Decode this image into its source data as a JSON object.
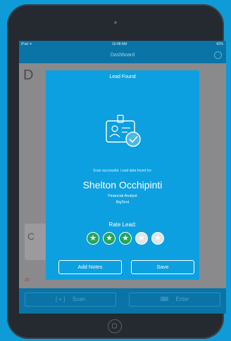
{
  "status": {
    "left": "iPad ᯤ",
    "time": "10:48 AM",
    "battery": "42%"
  },
  "nav": {
    "title": "Dashboard"
  },
  "background": {
    "title": "D",
    "card_letter": "C",
    "number": "20"
  },
  "modal": {
    "title": "Lead Found",
    "status": "Scan successful. Lead data found for:",
    "name": "Shelton Occhipinti",
    "job_title": "Financial Analyst",
    "company": "BigTent",
    "rate_label": "Rate Lead:",
    "rating": 3,
    "rating_max": 5,
    "add_notes_label": "Add Notes",
    "save_label": "Save"
  },
  "bottom_bar": {
    "scan_icon": "[ + ]",
    "scan_label": "Scan",
    "enter_icon": "⌨",
    "enter_label": "Enter"
  },
  "colors": {
    "accent": "#0da0e0",
    "star_filled": "#21a65a",
    "star_empty": "#dfe4e7",
    "page_bg": "#0f9bd7"
  }
}
